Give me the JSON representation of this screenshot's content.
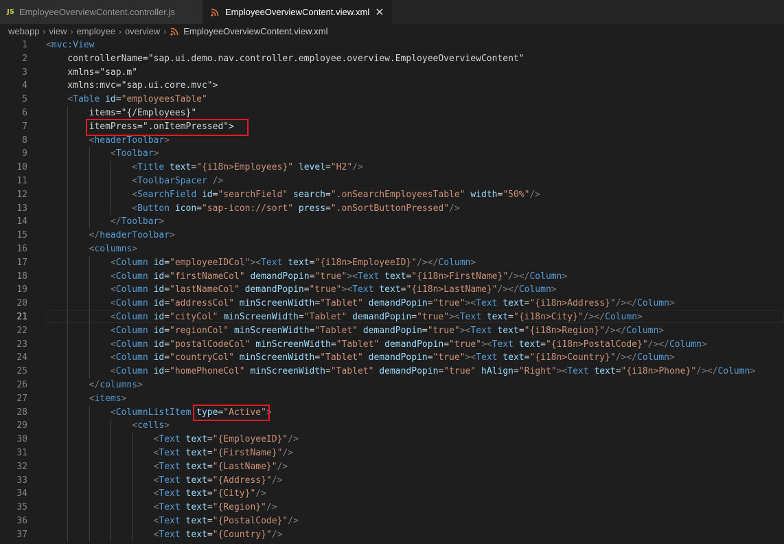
{
  "tabs": [
    {
      "label": "EmployeeOverviewContent.controller.js",
      "icon": "js-icon",
      "icon_text": "JS",
      "active": false
    },
    {
      "label": "EmployeeOverviewContent.view.xml",
      "icon": "rss-xml-icon",
      "active": true,
      "close": "✕"
    }
  ],
  "breadcrumb": {
    "items": [
      "webapp",
      "view",
      "employee",
      "overview"
    ],
    "file": "EmployeeOverviewContent.view.xml",
    "separator": "›"
  },
  "editor": {
    "current_line": 21,
    "highlighted_lines": [
      7,
      28
    ],
    "lines": [
      {
        "n": "1",
        "text": "<mvc:View"
      },
      {
        "n": "2",
        "text": "    controllerName=\"sap.ui.demo.nav.controller.employee.overview.EmployeeOverviewContent\""
      },
      {
        "n": "3",
        "text": "    xmlns=\"sap.m\""
      },
      {
        "n": "4",
        "text": "    xmlns:mvc=\"sap.ui.core.mvc\">"
      },
      {
        "n": "5",
        "text": "    <Table id=\"employeesTable\""
      },
      {
        "n": "6",
        "text": "        items=\"{/Employees}\""
      },
      {
        "n": "7",
        "text": "        itemPress=\".onItemPressed\">"
      },
      {
        "n": "8",
        "text": "        <headerToolbar>"
      },
      {
        "n": "9",
        "text": "            <Toolbar>"
      },
      {
        "n": "10",
        "text": "                <Title text=\"{i18n>Employees}\" level=\"H2\"/>"
      },
      {
        "n": "11",
        "text": "                <ToolbarSpacer />"
      },
      {
        "n": "12",
        "text": "                <SearchField id=\"searchField\" search=\".onSearchEmployeesTable\" width=\"50%\"/>"
      },
      {
        "n": "13",
        "text": "                <Button icon=\"sap-icon://sort\" press=\".onSortButtonPressed\"/>"
      },
      {
        "n": "14",
        "text": "            </Toolbar>"
      },
      {
        "n": "15",
        "text": "        </headerToolbar>"
      },
      {
        "n": "16",
        "text": "        <columns>"
      },
      {
        "n": "17",
        "text": "            <Column id=\"employeeIDCol\"><Text text=\"{i18n>EmployeeID}\"/></Column>"
      },
      {
        "n": "18",
        "text": "            <Column id=\"firstNameCol\" demandPopin=\"true\"><Text text=\"{i18n>FirstName}\"/></Column>"
      },
      {
        "n": "19",
        "text": "            <Column id=\"lastNameCol\" demandPopin=\"true\"><Text text=\"{i18n>LastName}\"/></Column>"
      },
      {
        "n": "20",
        "text": "            <Column id=\"addressCol\" minScreenWidth=\"Tablet\" demandPopin=\"true\"><Text text=\"{i18n>Address}\"/></Column>"
      },
      {
        "n": "21",
        "text": "            <Column id=\"cityCol\" minScreenWidth=\"Tablet\" demandPopin=\"true\"><Text text=\"{i18n>City}\"/></Column>"
      },
      {
        "n": "22",
        "text": "            <Column id=\"regionCol\" minScreenWidth=\"Tablet\" demandPopin=\"true\"><Text text=\"{i18n>Region}\"/></Column>"
      },
      {
        "n": "23",
        "text": "            <Column id=\"postalCodeCol\" minScreenWidth=\"Tablet\" demandPopin=\"true\"><Text text=\"{i18n>PostalCode}\"/></Column>"
      },
      {
        "n": "24",
        "text": "            <Column id=\"countryCol\" minScreenWidth=\"Tablet\" demandPopin=\"true\"><Text text=\"{i18n>Country}\"/></Column>"
      },
      {
        "n": "25",
        "text": "            <Column id=\"homePhoneCol\" minScreenWidth=\"Tablet\" demandPopin=\"true\" hAlign=\"Right\"><Text text=\"{i18n>Phone}\"/></Column>"
      },
      {
        "n": "26",
        "text": "        </columns>"
      },
      {
        "n": "27",
        "text": "        <items>"
      },
      {
        "n": "28",
        "text": "            <ColumnListItem type=\"Active\">"
      },
      {
        "n": "29",
        "text": "                <cells>"
      },
      {
        "n": "30",
        "text": "                    <Text text=\"{EmployeeID}\"/>"
      },
      {
        "n": "31",
        "text": "                    <Text text=\"{FirstName}\"/>"
      },
      {
        "n": "32",
        "text": "                    <Text text=\"{LastName}\"/>"
      },
      {
        "n": "33",
        "text": "                    <Text text=\"{Address}\"/>"
      },
      {
        "n": "34",
        "text": "                    <Text text=\"{City}\"/>"
      },
      {
        "n": "35",
        "text": "                    <Text text=\"{Region}\"/>"
      },
      {
        "n": "36",
        "text": "                    <Text text=\"{PostalCode}\"/>"
      },
      {
        "n": "37",
        "text": "                    <Text text=\"{Country}\"/>"
      }
    ]
  },
  "colors": {
    "background": "#1e1e1e",
    "tag": "#569cd6",
    "attribute": "#9cdcfe",
    "string": "#ce9178",
    "punctuation": "#808080",
    "highlight_box": "#e51b24"
  }
}
